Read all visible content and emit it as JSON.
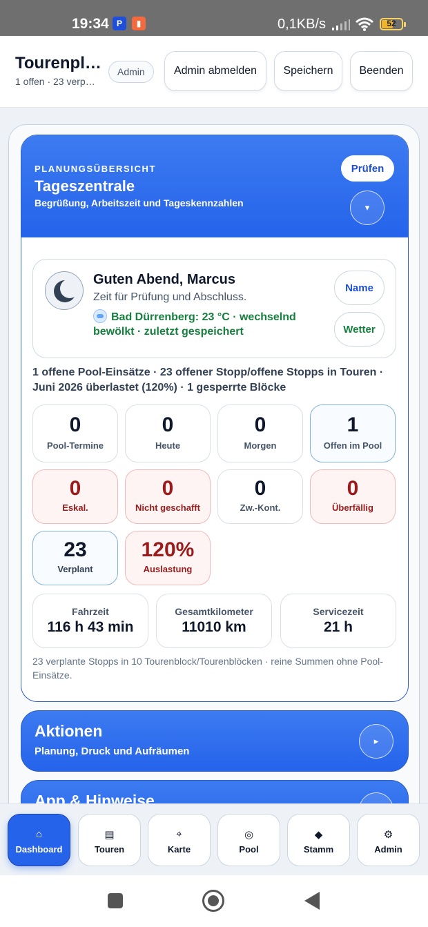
{
  "status_bar": {
    "time": "19:34",
    "network_speed": "0,1KB/s",
    "battery": "52",
    "battery_fraction": 0.52,
    "icons": [
      "paypal-icon",
      "recorder-icon",
      "signal-icon",
      "wifi-icon",
      "battery-icon"
    ]
  },
  "header": {
    "title": "Tourenpl…",
    "subtitle": "1 offen · 23 verp…",
    "role_badge": "Admin",
    "logout_label": "Admin abmelden",
    "save_label": "Speichern",
    "quit_label": "Beenden"
  },
  "overview": {
    "eyebrow": "PLANUNGSÜBERSICHT",
    "title": "Tageszentrale",
    "description": "Begrüßung, Arbeitszeit und Tageskennzahlen",
    "check_label": "Prüfen",
    "toggle_icon": "▾"
  },
  "greeting": {
    "headline": "Guten Abend, Marcus",
    "text": "Zeit für Prüfung und Abschluss.",
    "weather": "Bad Dürrenberg: 23 °C · wechselnd bewölkt · zuletzt gespeichert",
    "name_label": "Name",
    "weather_label": "Wetter"
  },
  "summary": "1 offene Pool-Einsätze · 23 offener Stopp/offene Stopps in Touren · Juni 2026 überlastet (120%) · 1 gesperrte Blöcke",
  "stats_row1": [
    {
      "value": "0",
      "label": "Pool-Termine"
    },
    {
      "value": "0",
      "label": "Heute"
    },
    {
      "value": "0",
      "label": "Morgen"
    },
    {
      "value": "1",
      "label": "Offen im Pool"
    }
  ],
  "stats_row2": [
    {
      "value": "0",
      "label": "Eskal."
    },
    {
      "value": "0",
      "label": "Nicht geschafft"
    },
    {
      "value": "0",
      "label": "Zw.-Kont."
    },
    {
      "value": "0",
      "label": "Überfällig"
    }
  ],
  "stats_row3": [
    {
      "value": "23",
      "label": "Verplant"
    },
    {
      "value": "120%",
      "label": "Auslastung"
    }
  ],
  "metrics": [
    {
      "label": "Fahrzeit",
      "value": "116 h 43 min"
    },
    {
      "label": "Gesamtkilometer",
      "value": "11010 km"
    },
    {
      "label": "Servicezeit",
      "value": "21 h"
    }
  ],
  "note": "23 verplante Stopps in 10 Tourenblock/Tourenblöcken · reine Summen ohne Pool-Einsätze.",
  "actions": {
    "title": "Aktionen",
    "subtitle": "Planung, Druck und Aufräumen",
    "toggle_icon": "▸"
  },
  "app_hints": {
    "title": "App & Hinweise"
  },
  "bottom_nav": [
    {
      "icon": "⌂",
      "label": "Dashboard"
    },
    {
      "icon": "▤",
      "label": "Touren"
    },
    {
      "icon": "⌖",
      "label": "Karte"
    },
    {
      "icon": "◎",
      "label": "Pool"
    },
    {
      "icon": "◆",
      "label": "Stamm"
    },
    {
      "icon": "⚙",
      "label": "Admin"
    }
  ],
  "colors": {
    "primary": "#2563eb",
    "danger_text": "#991b1b",
    "success_text": "#15803d",
    "danger_bg": "#fff4f4"
  }
}
